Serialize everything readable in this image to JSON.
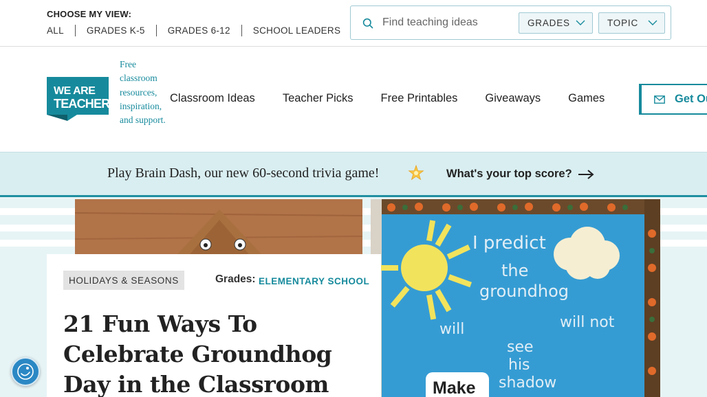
{
  "topbar": {
    "choose_label": "CHOOSE MY VIEW:",
    "view_links": [
      "ALL",
      "GRADES K-5",
      "GRADES 6-12",
      "SCHOOL LEADERS"
    ],
    "search_placeholder": "Find teaching ideas",
    "grades_filter": "GRADES",
    "topic_filter": "TOPIC"
  },
  "header": {
    "logo_text_line1": "WE ARE",
    "logo_text_line2": "TEACHERS",
    "tagline": "Free classroom resources, inspiration, and support.",
    "nav": [
      "Classroom Ideas",
      "Teacher Picks",
      "Free Printables",
      "Giveaways",
      "Games"
    ],
    "newsletter_label": "Get Ou"
  },
  "promo": {
    "text": "Play Brain Dash, our new 60-second trivia game!",
    "link": "What's your top score?"
  },
  "article": {
    "category": "HOLIDAYS & SEASONS",
    "grades_label": "Grades:",
    "grades_value": "ELEMENTARY SCHOOL",
    "title": "21 Fun Ways To Celebrate Groundhog Day in the Classroom"
  },
  "hero_image": {
    "board_line1": "I predict",
    "board_line2": "the",
    "board_line3": "groundhog",
    "board_will": "will",
    "board_will_not": "will not",
    "board_see": "see",
    "board_his": "his",
    "board_shadow": "shadow",
    "board_make": "Make"
  },
  "colors": {
    "brand_teal": "#168a9c",
    "promo_bg": "#d9eef1",
    "hero_bg": "#e7f4f6"
  },
  "icons": {
    "search": "search-icon",
    "chevron": "chevron-down-icon",
    "mail": "mail-icon",
    "star": "star-icon",
    "arrow": "arrow-right-icon",
    "accessibility": "accessibility-icon"
  }
}
